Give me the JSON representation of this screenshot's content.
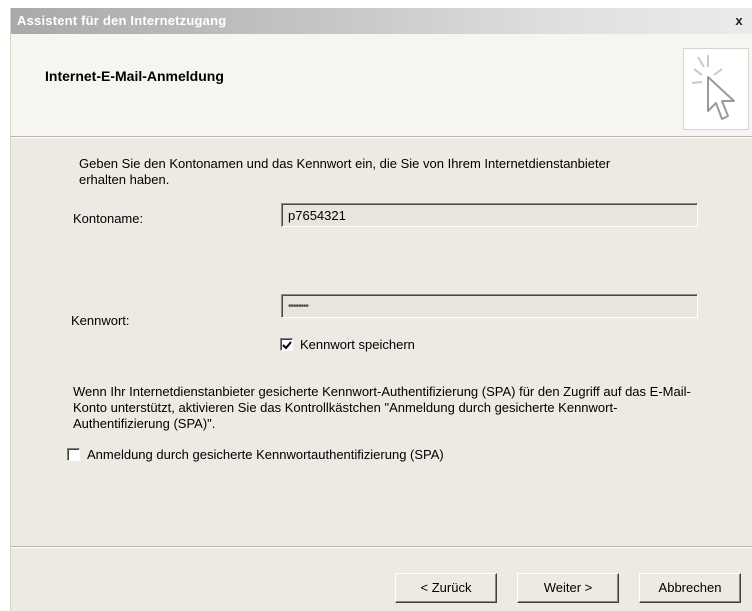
{
  "window": {
    "title": "Assistent für den Internetzugang",
    "close_label": "x"
  },
  "header": {
    "title": "Internet-E-Mail-Anmeldung",
    "icon": "wizard-cursor-icon"
  },
  "intro_text": "Geben Sie den Kontonamen und das Kennwort ein, die Sie von Ihrem Internetdienstanbieter erhalten haben.",
  "account": {
    "label": "Kontoname:",
    "value": "p7654321"
  },
  "password": {
    "label": "Kennwort:",
    "value": "••••••••",
    "save_label": "Kennwort speichern",
    "save_checked": true
  },
  "spa": {
    "description": "Wenn Ihr Internetdienstanbieter gesicherte Kennwort-Authentifizierung (SPA) für den Zugriff auf das E-Mail-Konto unterstützt, aktivieren Sie das Kontrollkästchen \"Anmeldung durch gesicherte Kennwort-Authentifizierung (SPA)\".",
    "checkbox_label": "Anmeldung durch gesicherte Kennwortauthentifizierung (SPA)",
    "checked": false
  },
  "buttons": {
    "back": "< Zurück",
    "next": "Weiter >",
    "cancel": "Abbrechen"
  }
}
